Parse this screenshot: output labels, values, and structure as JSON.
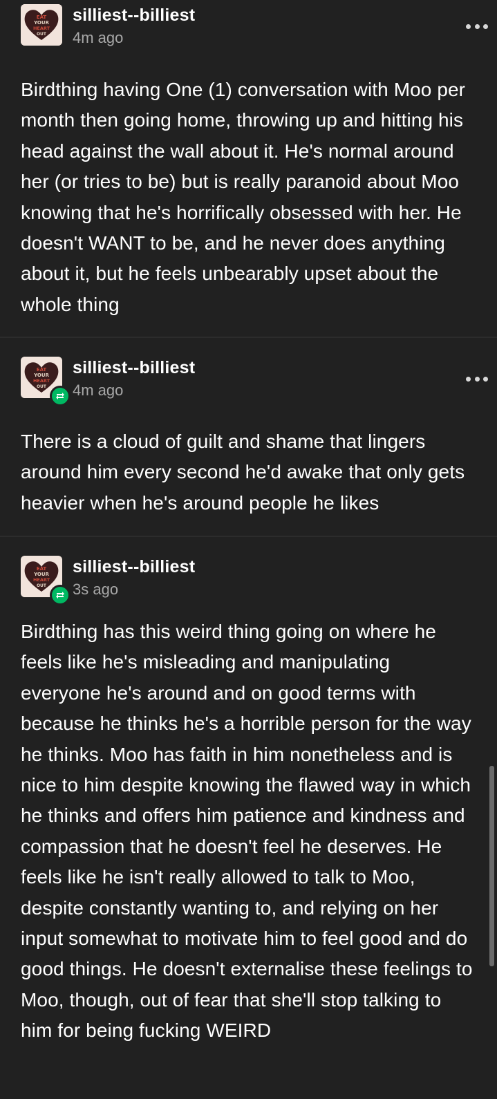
{
  "posts": [
    {
      "username": "silliest--billiest",
      "timestamp": "4m ago",
      "reblogged": false,
      "body": "Birdthing having One (1) conversation with Moo per month then going home, throwing up and hitting his head against the wall about it. He's normal around her (or tries to be) but is really paranoid about Moo knowing that he's horrifically obsessed with her. He doesn't WANT to be, and he never does anything about it, but he feels unbearably upset about the whole thing"
    },
    {
      "username": "silliest--billiest",
      "timestamp": "4m ago",
      "reblogged": true,
      "body": "There is a cloud of guilt and shame that lingers around him every second he'd awake that only gets heavier when he's around people he likes"
    },
    {
      "username": "silliest--billiest",
      "timestamp": "3s ago",
      "reblogged": true,
      "body": "Birdthing has this weird thing going on where he feels like he's misleading and manipulating everyone he's around and on good terms with because he thinks he's a horrible person for the way he thinks. Moo has faith in him nonetheless and is nice to him despite knowing the flawed way in which he thinks and offers him patience and kindness and compassion that he doesn't feel he deserves. He feels like he isn't really allowed to talk to Moo, despite constantly wanting to, and relying on her input somewhat to motivate him to feel good and do good things. He doesn't externalise these feelings to Moo, though, out of fear that she'll stop talking to him for being fucking WEIRD"
    }
  ],
  "avatar": {
    "icon": "avatar-image",
    "text_lines": [
      "EAT",
      "YOUR",
      "HEART",
      "OUT"
    ],
    "colors": {
      "background": "#f2e4dc",
      "heart": "#3a1c1c",
      "text": "#c94a3a"
    }
  },
  "icons": {
    "more": "more-options-icon",
    "reblog": "reblog-icon"
  },
  "colors": {
    "page_background": "#212121",
    "text": "#ffffff",
    "timestamp": "#a8a8a8",
    "reblog_badge": "#00b862"
  }
}
